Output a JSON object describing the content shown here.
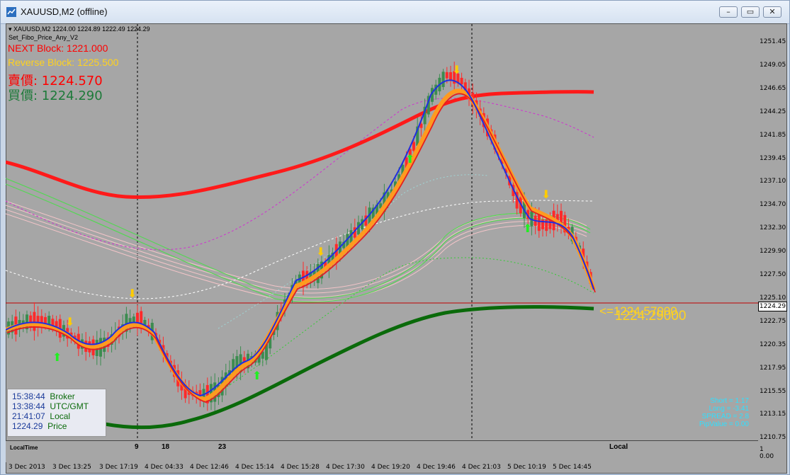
{
  "window": {
    "title": "XAUUSD,M2 (offline)"
  },
  "header": {
    "symbol_line": "XAUUSD,M2  1224.00 1224.89 1222.49 1224.29",
    "indicator_name": "Set_Fibo_Price_Any_V2",
    "next_block": "NEXT Block: 1221.000",
    "reverse_block": "Reverse Block: 1225.500",
    "sell_price": "賣價: 1224.570",
    "buy_price": "買價: 1224.290"
  },
  "price_axis": [
    "1251.45",
    "1249.05",
    "1246.65",
    "1244.25",
    "1241.85",
    "1239.45",
    "1237.10",
    "1234.70",
    "1232.30",
    "1229.90",
    "1227.50",
    "1225.10",
    "1222.75",
    "1220.35",
    "1217.95",
    "1215.55",
    "1213.15",
    "1210.75"
  ],
  "current_price": "1224.29",
  "price_markers": {
    "ask": "<=1224.57000",
    "bid": "1224.29000"
  },
  "time_axis": [
    "3 Dec 2013",
    "3 Dec 13:25",
    "3 Dec 17:19",
    "4 Dec 04:33",
    "4 Dec 12:46",
    "4 Dec 15:14",
    "4 Dec 15:28",
    "4 Dec 17:30",
    "4 Dec 19:20",
    "4 Dec 19:46",
    "4 Dec 21:03",
    "5 Dec 10:19",
    "5 Dec 14:45"
  ],
  "subpanel": {
    "label": "LocalTime",
    "marks": [
      "9",
      "18",
      "23"
    ],
    "right_label": "Local",
    "scale_top": "1",
    "scale_bottom": "0.00"
  },
  "clock": [
    {
      "time": "15:38:44",
      "label": "Broker"
    },
    {
      "time": "13:38:44",
      "label": "UTC/GMT"
    },
    {
      "time": "21:41:07",
      "label": "Local"
    },
    {
      "time": "1224.29",
      "label": "Price"
    }
  ],
  "stats": [
    "Short = 1.17",
    "Long = -3.41",
    "SPREAD = 2.8",
    "PipValue = 0.00"
  ],
  "colors": {
    "background": "#a6a6a6",
    "bull": "#3c8c50",
    "bear": "#ff2a2a",
    "red_ma": "#ff0000",
    "green_ma": "#0b6b0b"
  }
}
